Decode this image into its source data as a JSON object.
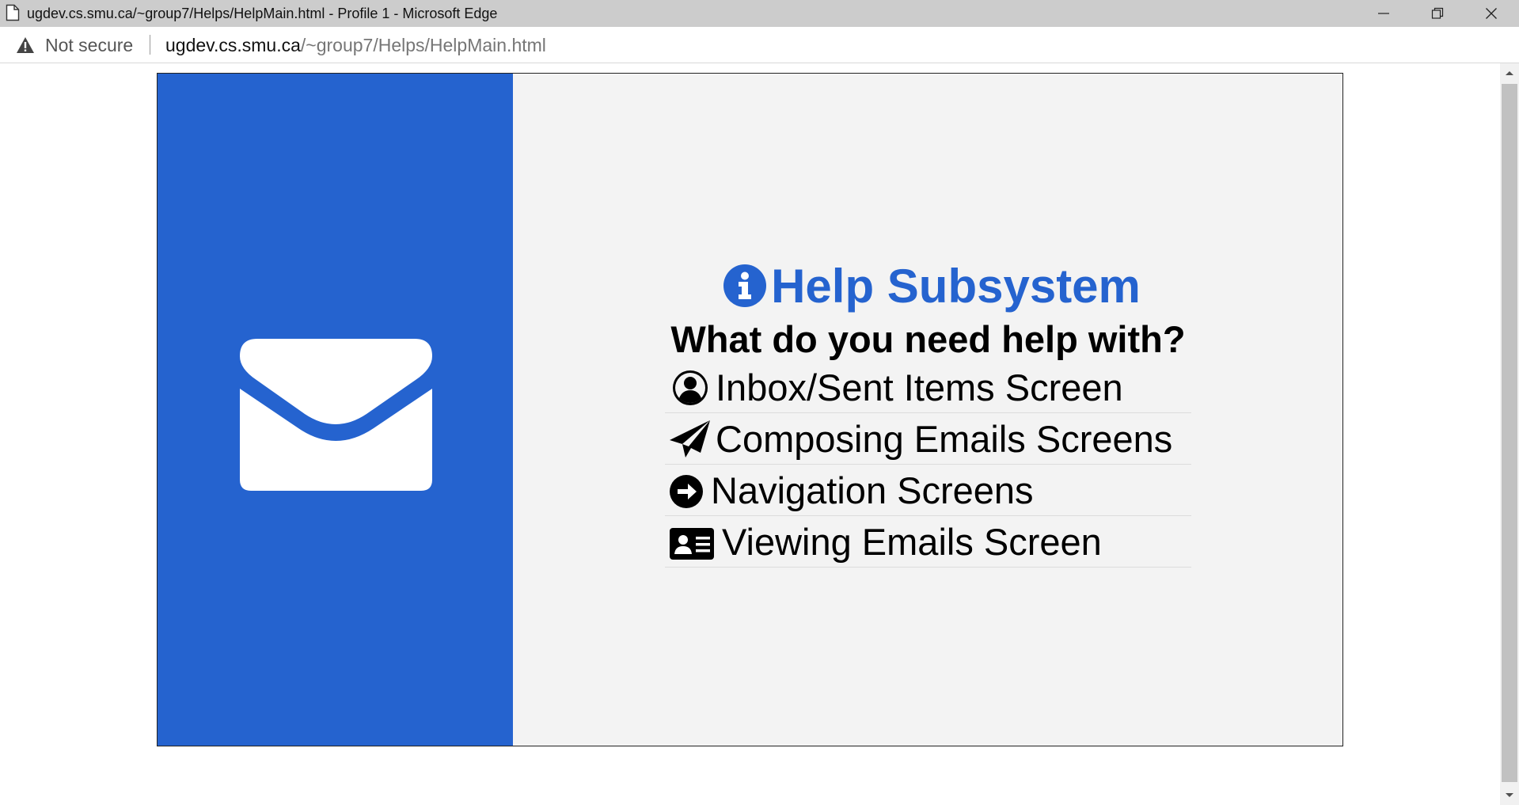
{
  "window": {
    "title": "ugdev.cs.smu.ca/~group7/Helps/HelpMain.html - Profile 1 - Microsoft Edge"
  },
  "address_bar": {
    "security_label": "Not secure",
    "url_host": "ugdev.cs.smu.ca",
    "url_path": "/~group7/Helps/HelpMain.html"
  },
  "colors": {
    "accent_blue": "#2563cf",
    "panel_background": "#f3f3f3",
    "titlebar": "#cccccc"
  },
  "help": {
    "title": "Help Subsystem",
    "question": "What do you need help with?",
    "topics": [
      {
        "label": "Inbox/Sent Items Screen",
        "icon": "user-circle-icon"
      },
      {
        "label": "Composing Emails Screens",
        "icon": "paper-plane-icon"
      },
      {
        "label": "Navigation Screens",
        "icon": "arrow-circle-right-icon"
      },
      {
        "label": "Viewing Emails Screen",
        "icon": "id-card-icon"
      }
    ]
  }
}
